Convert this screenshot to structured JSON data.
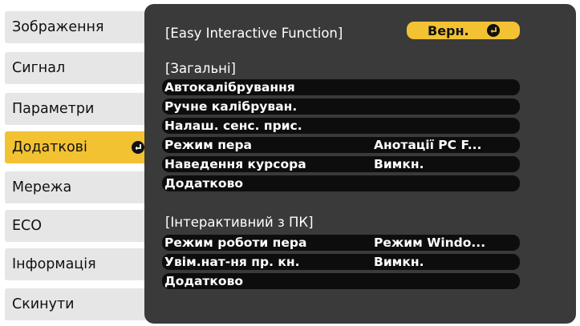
{
  "menu": {
    "items": [
      {
        "label": "Зображення"
      },
      {
        "label": "Сигнал"
      },
      {
        "label": "Параметри"
      },
      {
        "label": "Додаткові"
      },
      {
        "label": "Мережа"
      },
      {
        "label": "ECO"
      },
      {
        "label": "Інформація"
      },
      {
        "label": "Скинути"
      }
    ],
    "active_label": "Додаткові"
  },
  "panel": {
    "header_title": "[Easy Interactive Function]",
    "back_label": "Верн.",
    "general": {
      "title": "[Загальні]",
      "rows": [
        {
          "label": "Автокалібрування",
          "value": ""
        },
        {
          "label": "Ручне калібруван.",
          "value": ""
        },
        {
          "label": "Налаш. сенс. прис.",
          "value": ""
        },
        {
          "label": "Режим пера",
          "value": "Анотації PC F..."
        },
        {
          "label": "Наведення курсора",
          "value": "Вимкн."
        },
        {
          "label": "Додатково",
          "value": ""
        }
      ]
    },
    "interactive": {
      "title": "[Інтерактивний з ПК]",
      "rows": [
        {
          "label": "Режим роботи пера",
          "value": "Режим Windo..."
        },
        {
          "label": "Увім.нат-ня пр. кн.",
          "value": "Вимкн."
        },
        {
          "label": "Додатково",
          "value": ""
        }
      ]
    }
  },
  "colors": {
    "accent": "#f2c233",
    "panel_bg": "#3a3a3a",
    "row_bg": "#0d0d0d",
    "menu_bg": "#e6e6e6"
  },
  "icons": {
    "enter": "enter-icon"
  }
}
